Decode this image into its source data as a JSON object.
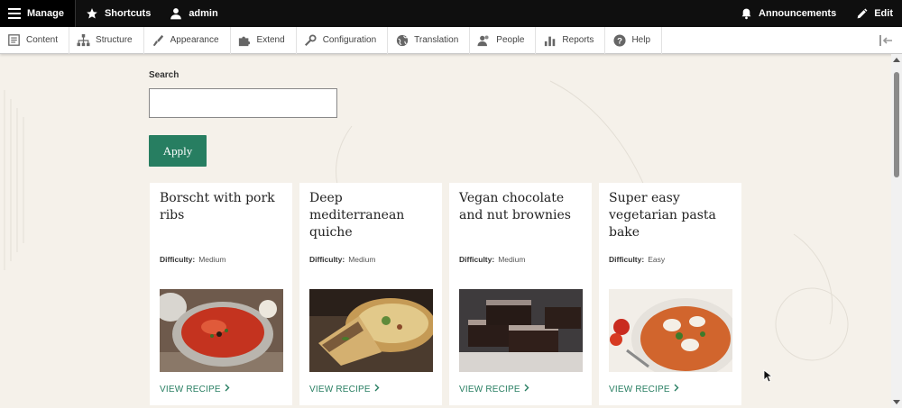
{
  "toolbar": {
    "manage": "Manage",
    "shortcuts": "Shortcuts",
    "user": "admin",
    "announcements": "Announcements",
    "edit": "Edit"
  },
  "tray": {
    "items": [
      {
        "label": "Content",
        "icon": "content-icon"
      },
      {
        "label": "Structure",
        "icon": "structure-icon"
      },
      {
        "label": "Appearance",
        "icon": "appearance-icon"
      },
      {
        "label": "Extend",
        "icon": "extend-icon"
      },
      {
        "label": "Configuration",
        "icon": "configuration-icon"
      },
      {
        "label": "Translation",
        "icon": "translation-icon"
      },
      {
        "label": "People",
        "icon": "people-icon"
      },
      {
        "label": "Reports",
        "icon": "reports-icon"
      },
      {
        "label": "Help",
        "icon": "help-icon"
      }
    ]
  },
  "search": {
    "label": "Search",
    "value": "",
    "placeholder": ""
  },
  "apply_label": "Apply",
  "difficulty_label": "Difficulty:",
  "recipes": [
    {
      "title": "Borscht with pork ribs",
      "difficulty": "Medium",
      "link": "VIEW RECIPE",
      "image": "borscht-soup"
    },
    {
      "title": "Deep mediterranean quiche",
      "difficulty": "Medium",
      "link": "VIEW RECIPE",
      "image": "quiche"
    },
    {
      "title": "Vegan chocolate and nut brownies",
      "difficulty": "Medium",
      "link": "VIEW RECIPE",
      "image": "brownies"
    },
    {
      "title": "Super easy vegetarian pasta bake",
      "difficulty": "Easy",
      "link": "VIEW RECIPE",
      "image": "pasta-bake"
    }
  ],
  "colors": {
    "accent": "#277e61",
    "toolbar_bg": "#0f0f0f",
    "page_bg": "#f5f1ea"
  }
}
